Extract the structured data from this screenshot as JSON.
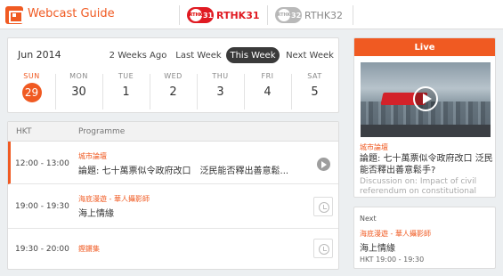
{
  "app": {
    "title": "Webcast Guide",
    "icon": "webcast-icon",
    "accent": "#f05a22"
  },
  "channels": [
    {
      "badge": "RTHK31",
      "name": "RTHK31",
      "active": true
    },
    {
      "badge": "RTHK32",
      "name": "RTHK32",
      "active": false
    }
  ],
  "calendar": {
    "month": "Jun 2014",
    "week_tabs": [
      "2 Weeks Ago",
      "Last Week",
      "This Week",
      "Next Week"
    ],
    "selected_tab": "This Week",
    "days": [
      {
        "name": "SUN",
        "num": "29",
        "today": true
      },
      {
        "name": "MON",
        "num": "30"
      },
      {
        "name": "TUE",
        "num": "1"
      },
      {
        "name": "WED",
        "num": "2"
      },
      {
        "name": "THU",
        "num": "3"
      },
      {
        "name": "FRI",
        "num": "4"
      },
      {
        "name": "SAT",
        "num": "5"
      }
    ]
  },
  "schedule": {
    "col_time": "HKT",
    "col_programme": "Programme",
    "rows": [
      {
        "time": "12:00 - 13:00",
        "series": "城市論壇",
        "title": "論題: 七十萬票似令政府改口　泛民能否釋出善意鬆...",
        "action": "play-icon",
        "current": true
      },
      {
        "time": "19:00 - 19:30",
        "series": "海底漫遊 - 華人攝影師",
        "title": "海上情緣",
        "action": "alarm-icon"
      },
      {
        "time": "19:30 - 20:00",
        "series": "鏗鏘集",
        "title": "",
        "action": "alarm-icon"
      }
    ]
  },
  "live": {
    "label": "Live",
    "series": "城市論壇",
    "title": "論題: 七十萬票似令政府改口 泛民能否釋出善意鬆手?",
    "subtitle_en": "Discussion on: Impact of civil referendum on constitutional"
  },
  "next": {
    "label": "Next",
    "series": "海底漫遊 - 華人攝影師",
    "title": "海上情緣",
    "time": "HKT 19:00 - 19:30"
  }
}
